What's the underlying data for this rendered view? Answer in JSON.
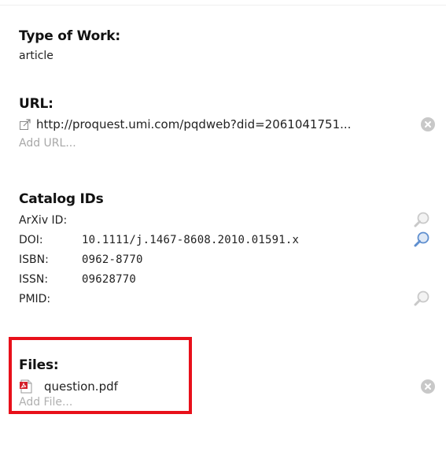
{
  "type_of_work": {
    "title": "Type of Work:",
    "value": "article"
  },
  "url": {
    "title": "URL:",
    "link": "http://proquest.umi.com/pqdweb?did=2061041751...",
    "add_label": "Add URL..."
  },
  "catalog": {
    "title": "Catalog IDs",
    "ids": [
      {
        "label": "ArXiv ID:",
        "value": ""
      },
      {
        "label": "DOI:",
        "value": "10.1111/j.1467-8608.2010.01591.x"
      },
      {
        "label": "ISBN:",
        "value": "0962-8770"
      },
      {
        "label": "ISSN:",
        "value": "09628770"
      },
      {
        "label": "PMID:",
        "value": ""
      }
    ]
  },
  "files": {
    "title": "Files:",
    "items": [
      {
        "name": "question.pdf",
        "icon": "pdf-file-icon"
      }
    ],
    "add_label": "Add File..."
  },
  "icons": {
    "external_link": "external-link-icon",
    "remove": "remove-circle-icon",
    "lookup": "magnifier-icon"
  },
  "colors": {
    "highlight": "#e8101a",
    "lookup_active": "#5f8fcf",
    "lookup_inactive": "#c9c9c9",
    "remove": "#c8c8c8",
    "add_text": "#a8a8a8"
  }
}
